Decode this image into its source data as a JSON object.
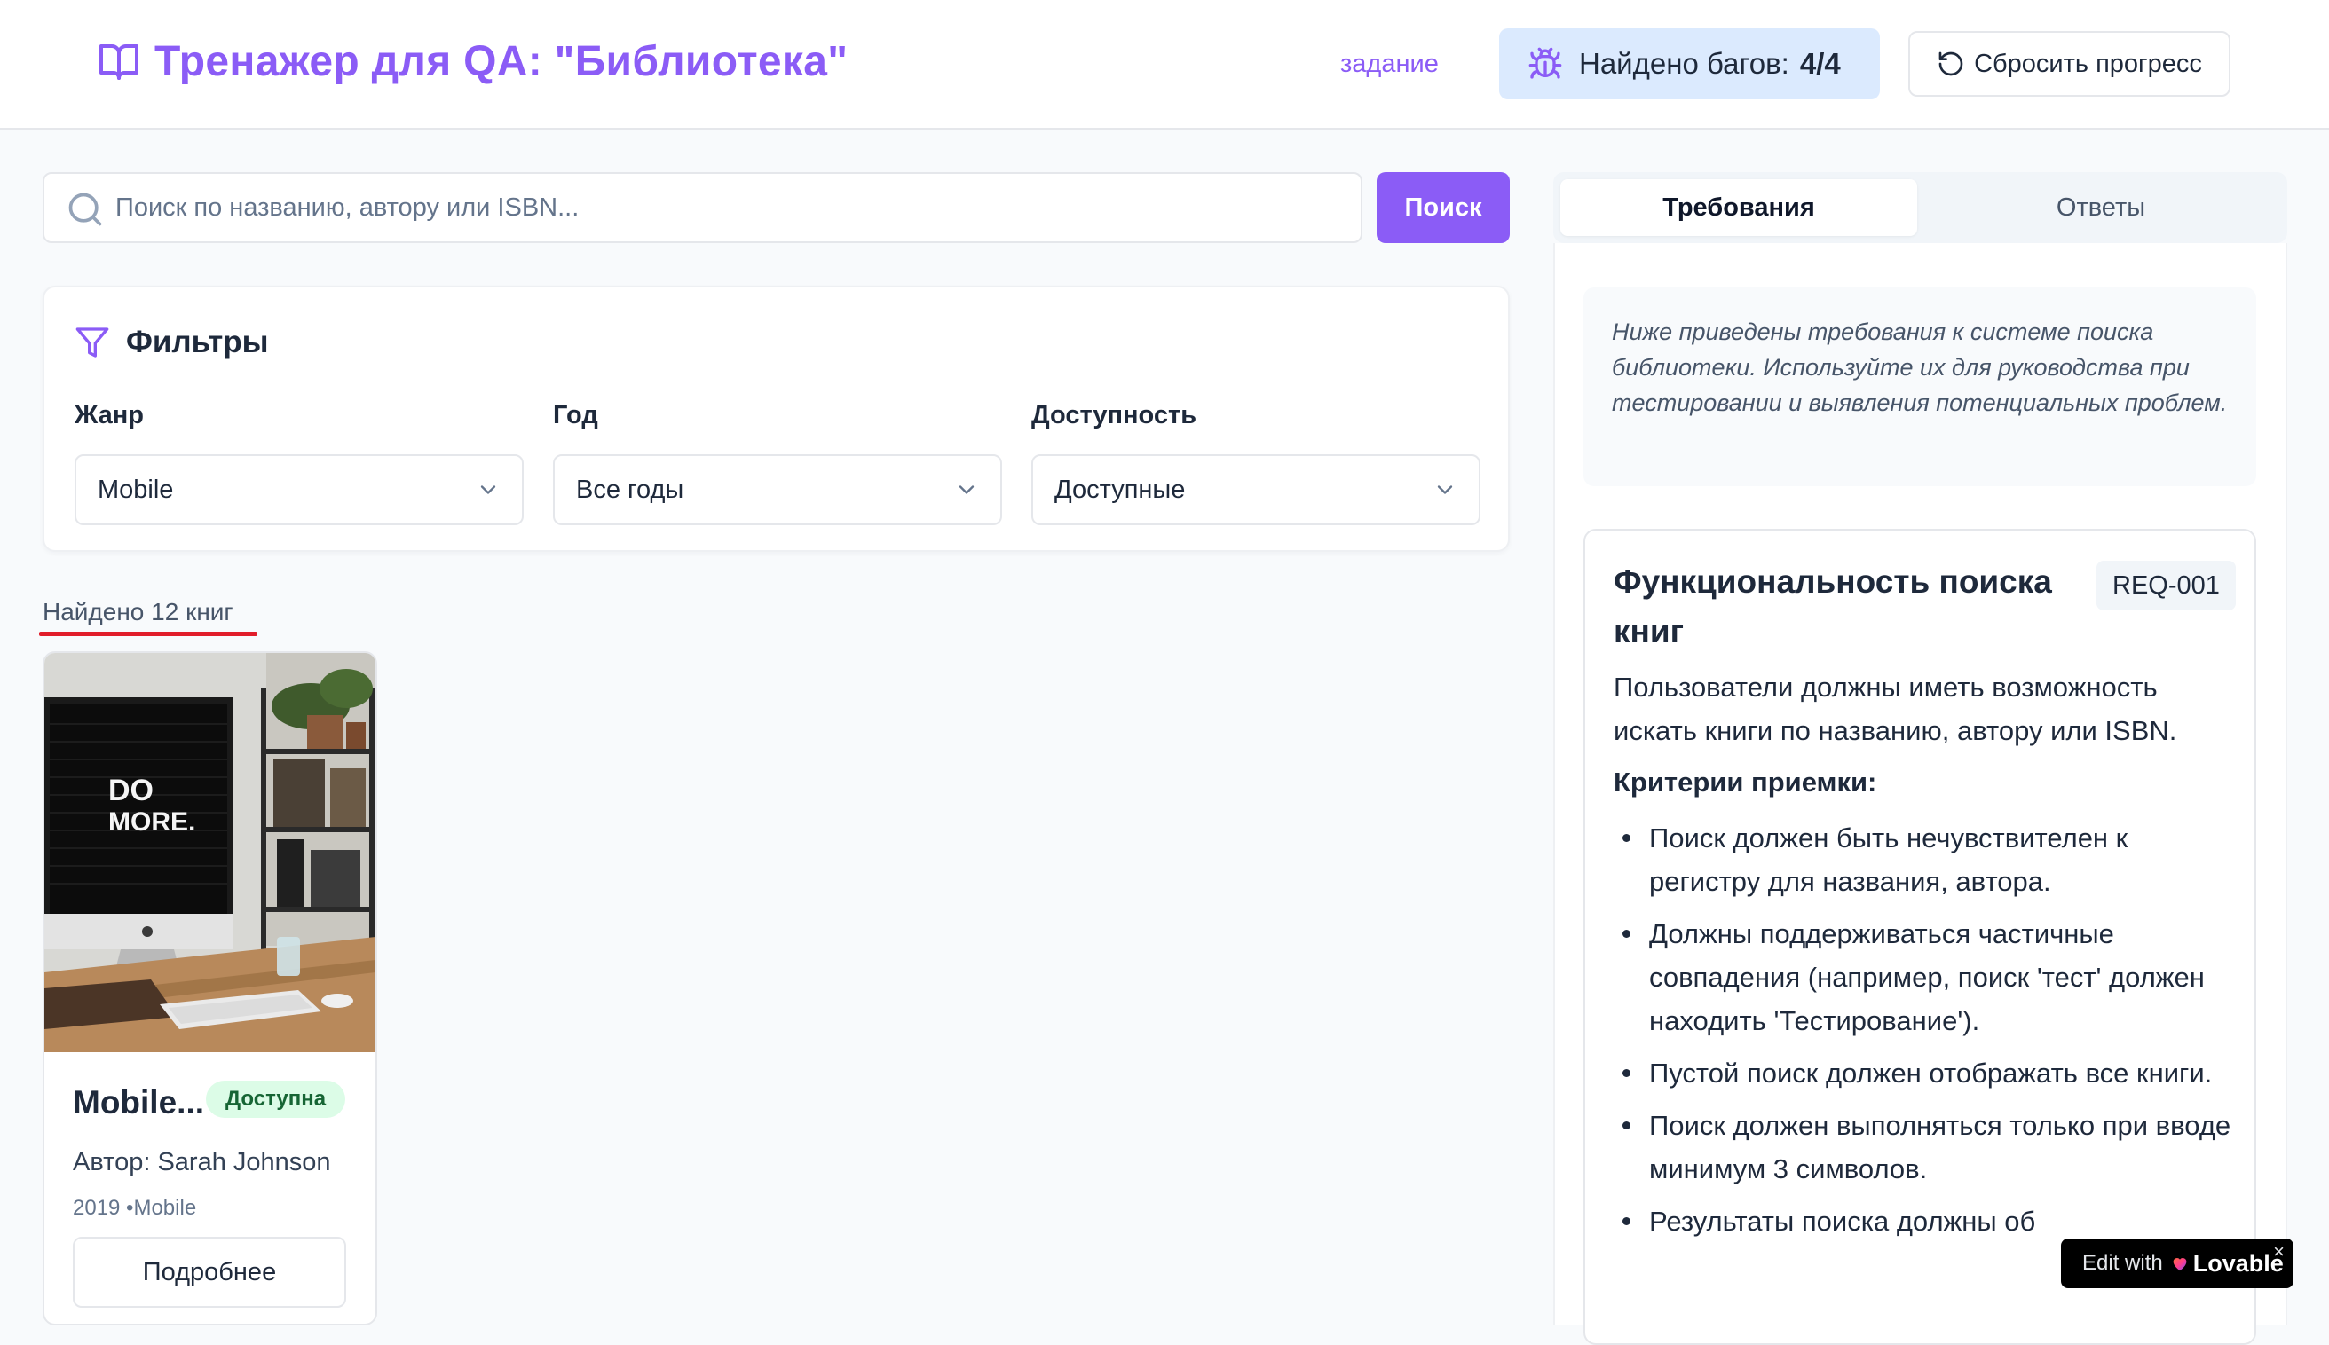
{
  "header": {
    "title": "Тренажер для QA: \"Библиотека\"",
    "task_link": "задание",
    "bugs_label": "Найдено багов:",
    "bugs_count": "4/4",
    "reset_label": "Сбросить прогресс"
  },
  "search": {
    "placeholder": "Поиск по названию, автору или ISBN...",
    "value": "",
    "button_label": "Поиск"
  },
  "filters": {
    "title": "Фильтры",
    "genre": {
      "label": "Жанр",
      "value": "Mobile"
    },
    "year": {
      "label": "Год",
      "value": "Все годы"
    },
    "availability": {
      "label": "Доступность",
      "value": "Доступные"
    }
  },
  "results": {
    "count_text": "Найдено 12 книг",
    "books": [
      {
        "title": "Mobile...",
        "status": "Доступна",
        "author": "Автор: Sarah Johnson",
        "meta": "2019 •Mobile",
        "details_label": "Подробнее",
        "image_text_line1": "DO",
        "image_text_line2": "MORE."
      }
    ]
  },
  "sidebar": {
    "tabs": [
      "Требования",
      "Ответы"
    ],
    "intro": "Ниже приведены требования к системе поиска библиотеки. Используйте их для руководства при тестировании и выявления потенциальных проблем.",
    "requirement": {
      "title": "Функциональность поиска книг",
      "code": "REQ-001",
      "description": "Пользователи должны иметь возможность искать книги по названию, автору или ISBN.",
      "criteria_title": "Критерии приемки:",
      "criteria": [
        "Поиск должен быть нечувствителен к регистру для названия, автора.",
        "Должны поддерживаться частичные совпадения (например, поиск 'тест' должен находить 'Тестирование').",
        "Пустой поиск должен отображать все книги.",
        "Поиск должен выполняться только при вводе минимум 3 символов.",
        "Результаты поиска должны об"
      ]
    }
  },
  "lovable": {
    "edit_label": "Edit with",
    "brand": "Lovable",
    "close": "×"
  },
  "colors": {
    "accent": "#8b5cf6",
    "badge_bg": "#dbeafe",
    "available_bg": "#dcfce7",
    "underline": "#e11d2a"
  }
}
